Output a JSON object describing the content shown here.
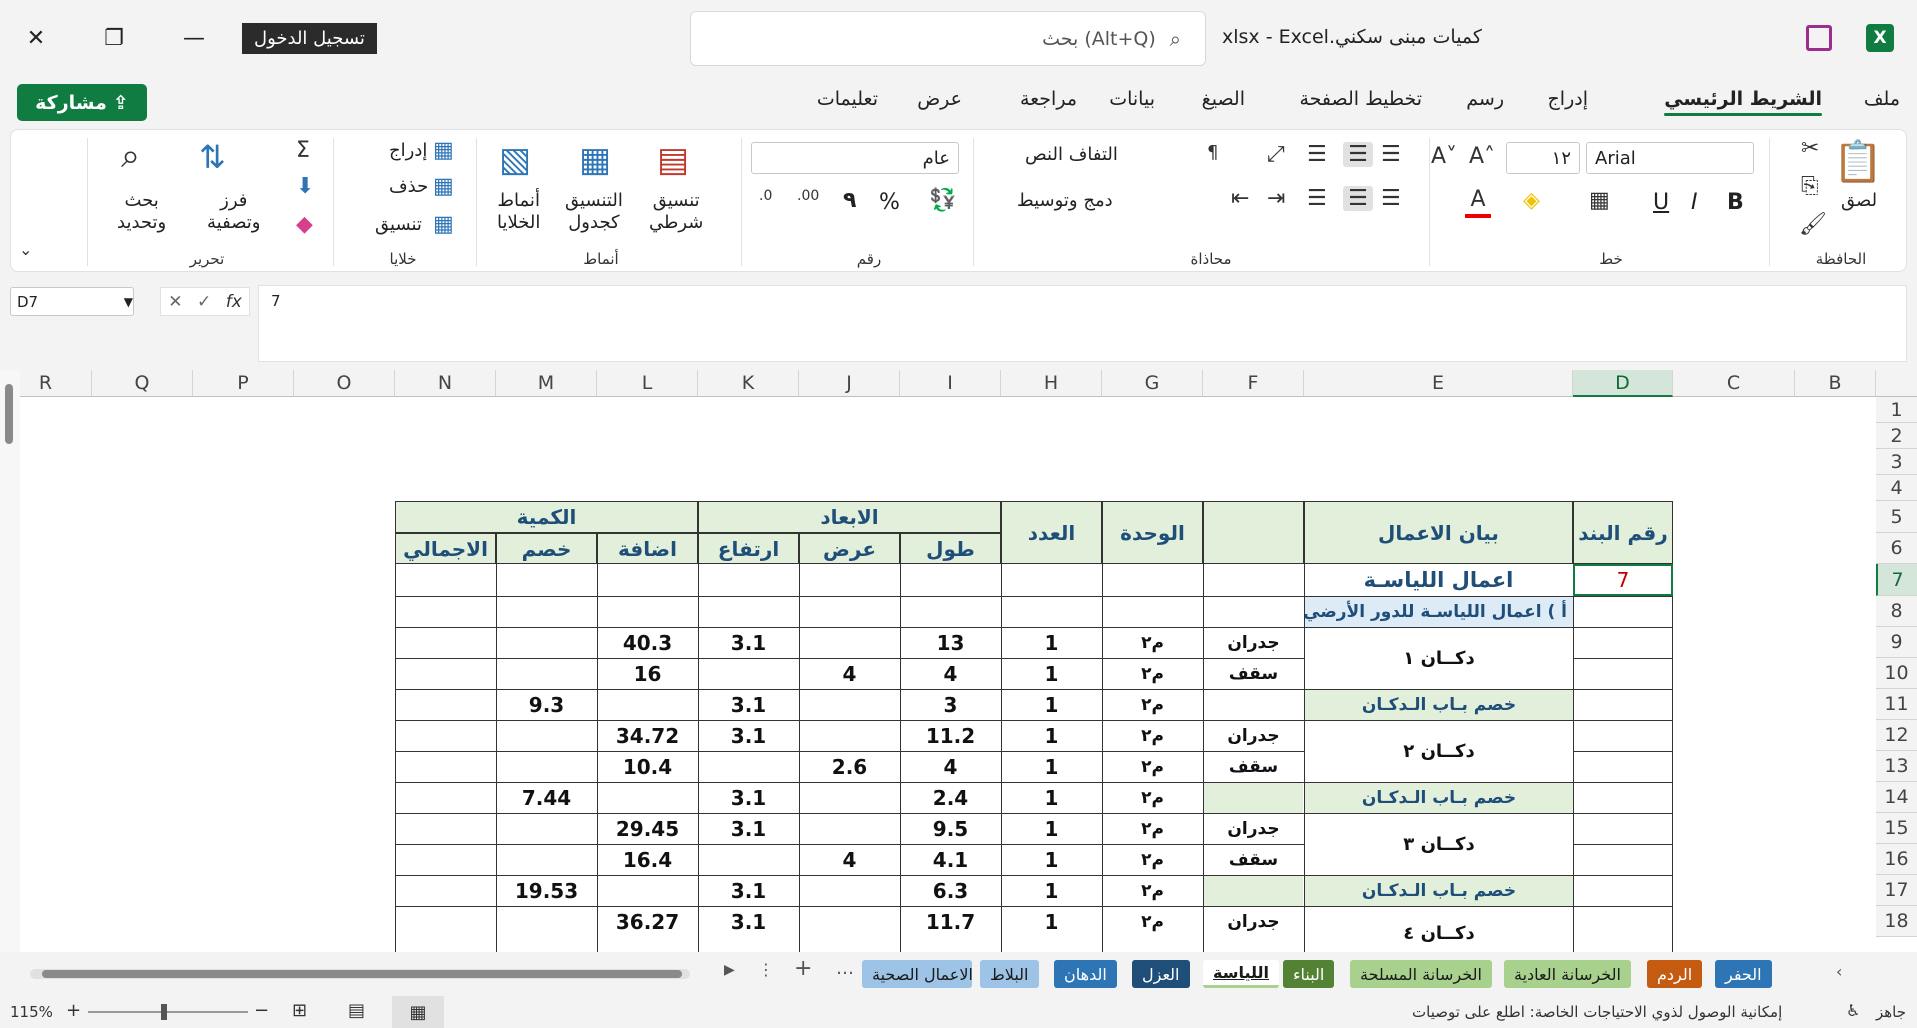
{
  "title_bar": {
    "doc_title": "كميات مبنى سكني.xlsx  -  Excel",
    "signin": "تسجيل الدخول",
    "search_placeholder": "بحث (Alt+Q)"
  },
  "tabs": [
    "ملف",
    "الشريط الرئيسي",
    "إدراج",
    "رسم",
    "تخطيط الصفحة",
    "الصيغ",
    "بيانات",
    "مراجعة",
    "عرض",
    "تعليمات"
  ],
  "share": "مشاركة",
  "ribbon": {
    "clipboard": {
      "paste": "لصق",
      "label": "الحافظة"
    },
    "font": {
      "name": "Arial",
      "size": "١٢",
      "bold": "B",
      "italic": "I",
      "underline": "U",
      "label": "خط"
    },
    "alignment": {
      "wrap": "التفاف النص",
      "merge": "دمج وتوسيط",
      "label": "محاذاة"
    },
    "number": {
      "format": "عام",
      "percent": "%",
      "comma": "٩",
      "label": "رقم"
    },
    "styles": {
      "conditional": "تنسيق\nشرطي",
      "table": "التنسيق\nكجدول",
      "cell": "أنماط\nالخلايا",
      "label": "أنماط"
    },
    "cells": {
      "insert": "إدراج",
      "delete": "حذف",
      "format": "تنسيق",
      "label": "خلايا"
    },
    "editing": {
      "sort": "فرز\nوتصفية",
      "find": "بحث\nوتحديد",
      "label": "تحرير"
    }
  },
  "formula_bar": {
    "name_box": "D7",
    "value": "7"
  },
  "columns": [
    "B",
    "C",
    "D",
    "E",
    "F",
    "G",
    "H",
    "I",
    "J",
    "K",
    "L",
    "M",
    "N",
    "O",
    "P",
    "Q",
    "R"
  ],
  "rows": [
    "1",
    "2",
    "3",
    "4",
    "5",
    "6",
    "7",
    "8",
    "9",
    "10",
    "11",
    "12",
    "13",
    "14",
    "15",
    "16",
    "17",
    "18"
  ],
  "table": {
    "h_item": "رقم البند",
    "h_desc": "بيان الاعمال",
    "h_unit": "الوحدة",
    "h_count": "العدد",
    "h_dims": "الابعاد",
    "h_len": "طول",
    "h_wid": "عرض",
    "h_hei": "ارتفاع",
    "h_qty": "الكمية",
    "h_add": "اضافة",
    "h_sub": "خصم",
    "h_total": "الاجمالي",
    "item_no": "7",
    "section_title": "اعمال اللياسـة",
    "sub_title": "أ ) اعمال اللياسـة  للدور الأرضي",
    "shop1": "دكــان ١",
    "shop2": "دكــان ٢",
    "shop3": "دكــان ٣",
    "shop4": "دكــان ٤",
    "door_deduct": "خصم بـاب الـدكـان",
    "walls": "جدران",
    "ceiling": "سقف",
    "unit": "م٢",
    "one": "1",
    "r9": {
      "len": "13",
      "hei": "3.1",
      "add": "40.3"
    },
    "r10": {
      "len": "4",
      "wid": "4",
      "add": "16"
    },
    "r11": {
      "len": "3",
      "hei": "3.1",
      "sub": "9.3"
    },
    "r12": {
      "len": "11.2",
      "hei": "3.1",
      "add": "34.72"
    },
    "r13": {
      "len": "4",
      "wid": "2.6",
      "add": "10.4"
    },
    "r14": {
      "len": "2.4",
      "hei": "3.1",
      "sub": "7.44"
    },
    "r15": {
      "len": "9.5",
      "hei": "3.1",
      "add": "29.45"
    },
    "r16": {
      "len": "4.1",
      "wid": "4",
      "add": "16.4"
    },
    "r17": {
      "len": "6.3",
      "hei": "3.1",
      "sub": "19.53"
    },
    "r18": {
      "len": "11.7",
      "hei": "3.1",
      "add": "36.27"
    }
  },
  "sheet_tabs": [
    {
      "name": "الحفر",
      "color": "#2e75b6"
    },
    {
      "name": "الردم",
      "color": "#c55a11"
    },
    {
      "name": "الخرسانة العادية",
      "color": "#a9d18e"
    },
    {
      "name": "الخرسانة المسلحة",
      "color": "#a9d18e"
    },
    {
      "name": "البناء",
      "color": "#548235"
    },
    {
      "name": "اللياسة",
      "color": "#a9d18e"
    },
    {
      "name": "العزل",
      "color": "#1f4e79"
    },
    {
      "name": "الدهان",
      "color": "#2e75b6"
    },
    {
      "name": "البلاط",
      "color": "#9dc3e6"
    },
    {
      "name": "الاعمال الصحية",
      "color": "#9dc3e6"
    }
  ],
  "status": {
    "ready": "جاهز",
    "accessibility": "إمكانية الوصول لذوي الاحتياجات الخاصة: اطلع على توصيات",
    "zoom": "115%"
  }
}
